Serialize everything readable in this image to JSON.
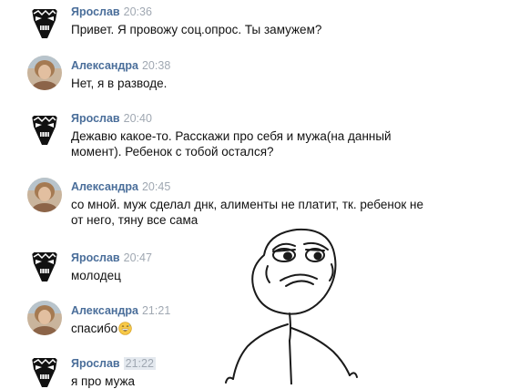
{
  "messages": [
    {
      "author": "Ярослав",
      "time": "20:36",
      "text": [
        "Привет. Я провожу соц.опрос. Ты замужем?"
      ],
      "avatar": "rage-face-avatar",
      "emoji": ""
    },
    {
      "author": "Александра",
      "time": "20:38",
      "text": [
        "Нет, я в разводе."
      ],
      "avatar": "user-photo-avatar",
      "emoji": ""
    },
    {
      "author": "Ярослав",
      "time": "20:40",
      "text": [
        "Дежавю какое-то. Расскажи про себя и мужа(на данный",
        "момент). Ребенок с тобой остался?"
      ],
      "avatar": "rage-face-avatar",
      "emoji": ""
    },
    {
      "author": "Александра",
      "time": "20:45",
      "text": [
        "со мной. муж сделал днк, алименты не платит, тк. ребенок не",
        "от него, тяну все сама"
      ],
      "avatar": "user-photo-avatar",
      "emoji": ""
    },
    {
      "author": "Ярослав",
      "time": "20:47",
      "text": [
        "молодец"
      ],
      "avatar": "rage-face-avatar",
      "emoji": ""
    },
    {
      "author": "Александра",
      "time": "21:21",
      "text": [
        "спасибо"
      ],
      "avatar": "user-photo-avatar",
      "emoji": "grinning-sweat-emoji"
    },
    {
      "author": "Ярослав",
      "time": "21:22",
      "text": [
        "я про мужа"
      ],
      "avatar": "rage-face-avatar",
      "emoji": ""
    }
  ],
  "overlay": {
    "icon": "suspicious-meme-face"
  }
}
